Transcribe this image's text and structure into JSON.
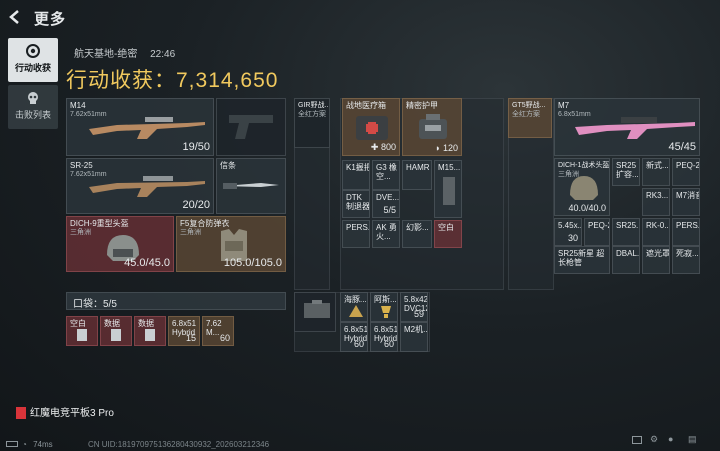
{
  "header": {
    "title": "更多"
  },
  "tabs": [
    {
      "label": "行动收获",
      "active": true
    },
    {
      "label": "击败列表",
      "active": false
    }
  ],
  "raid": {
    "map": "航天基地-绝密",
    "time": "22:46",
    "haul_label": "行动收获：",
    "haul_value": "7,314,650"
  },
  "weapons": [
    {
      "name": "M14",
      "caliber": "7.62x51mm",
      "ammo": "19/50"
    },
    {
      "name": "SR-25",
      "caliber": "7.62x51mm",
      "ammo": "20/20"
    },
    {
      "name": "",
      "caliber": "",
      "ammo": ""
    },
    {
      "name": "信条",
      "caliber": "",
      "ammo": ""
    }
  ],
  "gear": [
    {
      "name": "DICH-9重型头盔",
      "sub": "三角洲",
      "durability": "45.0/45.0"
    },
    {
      "name": "F5复合防弹衣",
      "sub": "三角洲",
      "durability": "105.0/105.0"
    }
  ],
  "pouch": {
    "label": "口袋：5/5",
    "items": [
      {
        "name": "空白",
        "count": ""
      },
      {
        "name": "数据",
        "count": ""
      },
      {
        "name": "数据",
        "count": ""
      },
      {
        "name": "6.8x51 Hybrid",
        "count": "15"
      },
      {
        "name": "7.62 M...",
        "count": "60"
      }
    ]
  },
  "rig": {
    "name": "GIR野战...",
    "sub": "全红方案"
  },
  "rig_items": [
    {
      "name": "战地医疗箱",
      "count": "800"
    },
    {
      "name": "精密护甲",
      "count": "120"
    },
    {
      "name": "K1握把",
      "count": ""
    },
    {
      "name": "G3 橡空...",
      "count": ""
    },
    {
      "name": "HAMR",
      "count": ""
    },
    {
      "name": "M15...",
      "count": ""
    },
    {
      "name": "DTK 制退器",
      "count": ""
    },
    {
      "name": "DVE...",
      "count": "5/5"
    },
    {
      "name": "PERS...",
      "count": ""
    },
    {
      "name": "AK 勇火...",
      "count": ""
    },
    {
      "name": "幻影...",
      "count": ""
    },
    {
      "name": "空白",
      "count": ""
    }
  ],
  "bag_items": [
    {
      "name": "",
      "count": ""
    },
    {
      "name": "海豚...",
      "count": ""
    },
    {
      "name": "阿斯...",
      "count": ""
    },
    {
      "name": "5.8x42 DVC12",
      "count": "59"
    },
    {
      "name": "6.8x51 Hybrid",
      "count": "60"
    },
    {
      "name": "6.8x51 Hybrid",
      "count": "60"
    },
    {
      "name": "M2机...",
      "count": ""
    }
  ],
  "rig2": {
    "name": "GT5野战...",
    "sub": "全红方案"
  },
  "m7": {
    "name": "M7",
    "caliber": "6.8x51mm",
    "ammo": "45/45"
  },
  "m7_items": [
    {
      "name": "DICH-1战术头盔",
      "sub": "三角洲",
      "count": "40.0/40.0"
    },
    {
      "name": "SR25 扩容...",
      "count": ""
    },
    {
      "name": "新式...",
      "count": ""
    },
    {
      "name": "PEQ-2",
      "count": ""
    },
    {
      "name": "RK3...",
      "count": ""
    },
    {
      "name": "M7消音",
      "count": ""
    },
    {
      "name": "5.45x...",
      "count": "30"
    },
    {
      "name": "PEQ-2",
      "count": ""
    },
    {
      "name": "SR25...",
      "count": ""
    },
    {
      "name": "RK-0...",
      "count": ""
    },
    {
      "name": "PERS...",
      "count": ""
    },
    {
      "name": "SR25新星 超长枪管",
      "count": ""
    },
    {
      "name": "DBAL...",
      "count": ""
    },
    {
      "name": "遮光罩",
      "count": ""
    },
    {
      "name": "死寂...",
      "count": ""
    }
  ],
  "footer": {
    "brand": "红魔电竞平板3 Pro",
    "latency": "74ms",
    "uid": "CN UID:1819709751362804309​32_202603212346"
  }
}
